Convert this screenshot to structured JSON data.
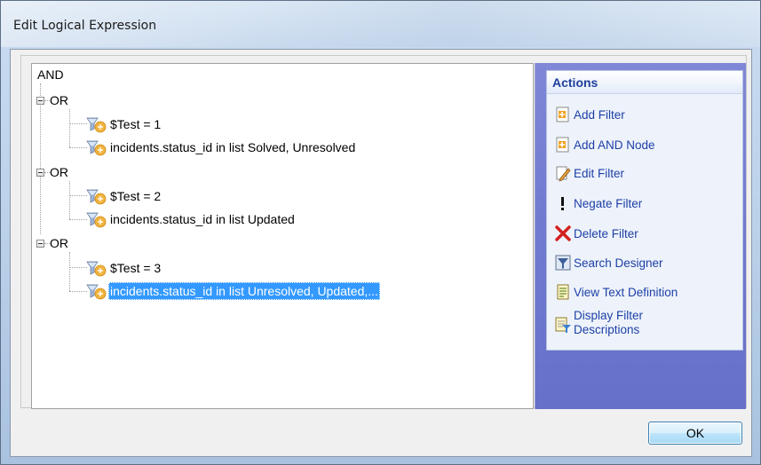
{
  "window": {
    "title": "Edit Logical Expression"
  },
  "tree": {
    "root": "AND",
    "groups": [
      {
        "label": "OR",
        "items": [
          "$Test = 1",
          "incidents.status_id in list Solved, Unresolved"
        ]
      },
      {
        "label": "OR",
        "items": [
          "$Test = 2",
          "incidents.status_id in list Updated"
        ]
      },
      {
        "label": "OR",
        "items": [
          "$Test = 3",
          "incidents.status_id in list Unresolved, Updated,..."
        ]
      }
    ],
    "selected": "incidents.status_id in list Unresolved, Updated,..."
  },
  "actions": {
    "header": "Actions",
    "items": [
      {
        "label": "Add Filter",
        "icon": "add-filter-icon"
      },
      {
        "label": "Add AND Node",
        "icon": "add-node-icon"
      },
      {
        "label": "Edit Filter",
        "icon": "edit-pencil-icon"
      },
      {
        "label": "Negate Filter",
        "icon": "exclamation-icon"
      },
      {
        "label": "Delete Filter",
        "icon": "red-x-icon"
      },
      {
        "label": "Search Designer",
        "icon": "search-designer-icon"
      },
      {
        "label": "View Text Definition",
        "icon": "text-document-icon"
      },
      {
        "label": "Display Filter Descriptions",
        "icon": "filter-descriptions-icon"
      }
    ]
  },
  "buttons": {
    "ok": "OK"
  },
  "colors": {
    "selection": "#3399ff",
    "action_text": "#1c3fa6",
    "actions_panel": "#6f7ad0"
  }
}
